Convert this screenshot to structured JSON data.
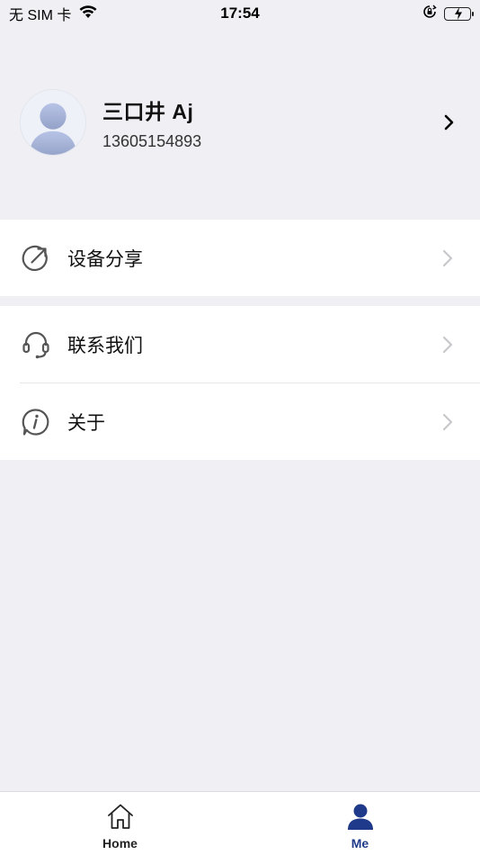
{
  "status_bar": {
    "carrier": "无 SIM 卡",
    "time": "17:54",
    "icons": [
      "wifi-icon",
      "orientation-lock-icon",
      "battery-charging-icon"
    ]
  },
  "profile": {
    "name": "三口井 Aj",
    "phone": "13605154893",
    "avatar_icon": "default-avatar-icon"
  },
  "menu": {
    "group1": [
      {
        "label": "设备分享",
        "icon": "share-icon"
      }
    ],
    "group2": [
      {
        "label": "联系我们",
        "icon": "headset-icon"
      },
      {
        "label": "关于",
        "icon": "info-icon"
      }
    ]
  },
  "tab_bar": {
    "tabs": [
      {
        "label": "Home",
        "icon": "home-icon",
        "active": false
      },
      {
        "label": "Me",
        "icon": "user-icon",
        "active": true
      }
    ]
  },
  "colors": {
    "background": "#efeff4",
    "active_tab": "#1f3a8a",
    "battery": "#4cd964"
  }
}
